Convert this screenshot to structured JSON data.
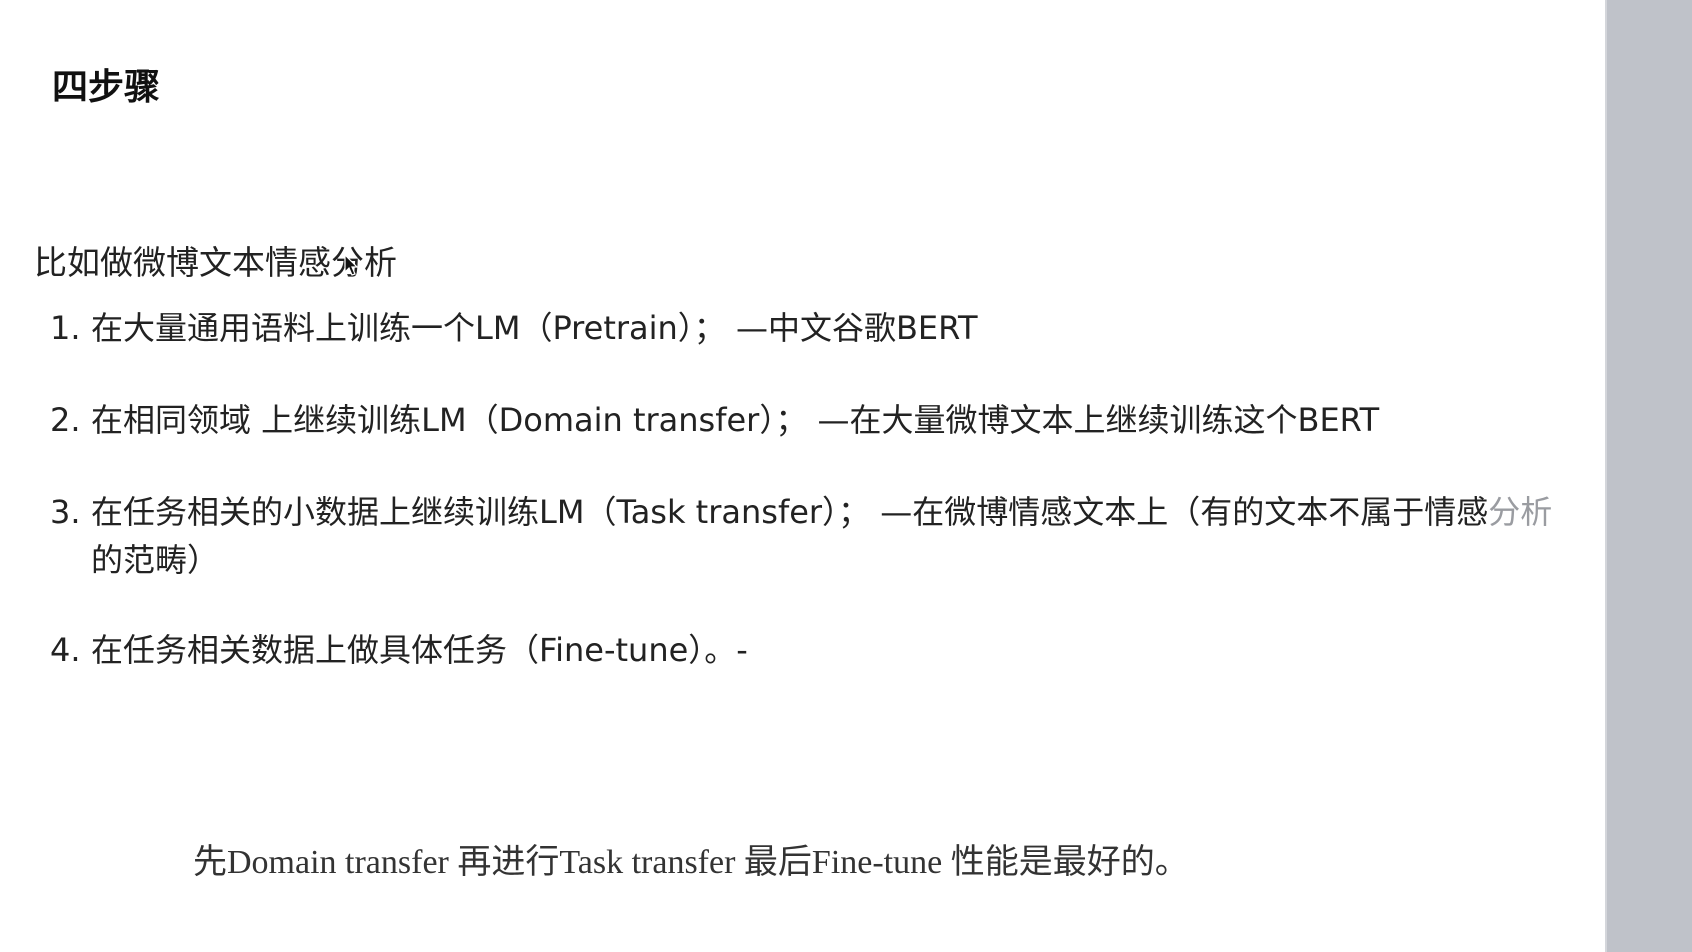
{
  "document": {
    "heading": "四步骤",
    "intro": "比如做微博文本情感分析",
    "steps": [
      {
        "number": "1.",
        "text": "在大量通用语料上训练一个LM（Pretrain）； —中文谷歌BERT"
      },
      {
        "number": "2.",
        "text": "在相同领域 上继续训练LM（Domain transfer）； —在大量微博文本上继续训练这个BERT"
      },
      {
        "number": "3.",
        "text": "在任务相关的小数据上继续训练LM（Task transfer）； —在微博情感文本上（有的文本不属于情感",
        "overflow": "分析",
        "continuation": "的范畴）"
      },
      {
        "number": "4.",
        "text": "在任务相关数据上做具体任务（Fine-tune）。-"
      }
    ]
  },
  "subtitle": {
    "caption": "先Domain transfer 再进行Task transfer 最后Fine-tune 性能是最好的。"
  },
  "colors": {
    "background": "#ffffff",
    "gutter": "#bfc2c9",
    "text": "#222222"
  }
}
